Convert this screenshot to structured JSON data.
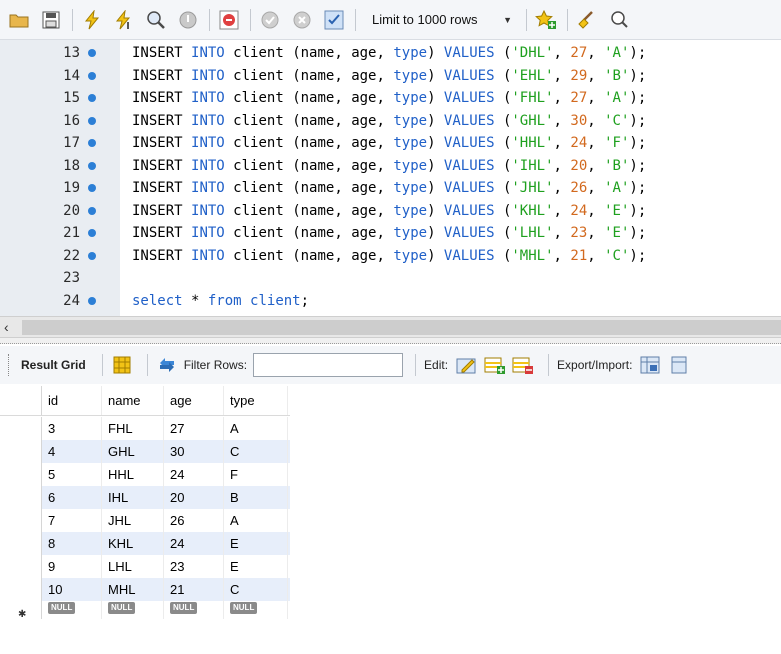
{
  "toolbar": {
    "limit_label": "Limit to 1000 rows",
    "icons": [
      "folder-icon",
      "save-icon",
      "lightning-icon",
      "lightning-cursor-icon",
      "magnifier-explain-icon",
      "stop-icon",
      "toggle-continue-icon",
      "commit-icon",
      "rollback-icon",
      "autocommit-icon",
      "beautify-icon",
      "find-icon",
      "invisible-chars-icon"
    ]
  },
  "editor": {
    "lines": [
      {
        "num": "13",
        "dot": true,
        "tokens": [
          [
            "k",
            "INSERT "
          ],
          [
            "b",
            "INTO "
          ],
          [
            "k",
            "client "
          ],
          [
            "k",
            "(name, age, "
          ],
          [
            "b",
            "type"
          ],
          [
            "k",
            ") "
          ],
          [
            "b",
            "VALUES "
          ],
          [
            "k",
            "("
          ],
          [
            "s",
            "'DHL'"
          ],
          [
            "k",
            ", "
          ],
          [
            "n",
            "27"
          ],
          [
            "k",
            ", "
          ],
          [
            "s",
            "'A'"
          ],
          [
            "k",
            ");"
          ]
        ]
      },
      {
        "num": "14",
        "dot": true,
        "tokens": [
          [
            "k",
            "INSERT "
          ],
          [
            "b",
            "INTO "
          ],
          [
            "k",
            "client "
          ],
          [
            "k",
            "(name, age, "
          ],
          [
            "b",
            "type"
          ],
          [
            "k",
            ") "
          ],
          [
            "b",
            "VALUES "
          ],
          [
            "k",
            "("
          ],
          [
            "s",
            "'EHL'"
          ],
          [
            "k",
            ", "
          ],
          [
            "n",
            "29"
          ],
          [
            "k",
            ", "
          ],
          [
            "s",
            "'B'"
          ],
          [
            "k",
            ");"
          ]
        ]
      },
      {
        "num": "15",
        "dot": true,
        "tokens": [
          [
            "k",
            "INSERT "
          ],
          [
            "b",
            "INTO "
          ],
          [
            "k",
            "client "
          ],
          [
            "k",
            "(name, age, "
          ],
          [
            "b",
            "type"
          ],
          [
            "k",
            ") "
          ],
          [
            "b",
            "VALUES "
          ],
          [
            "k",
            "("
          ],
          [
            "s",
            "'FHL'"
          ],
          [
            "k",
            ", "
          ],
          [
            "n",
            "27"
          ],
          [
            "k",
            ", "
          ],
          [
            "s",
            "'A'"
          ],
          [
            "k",
            ");"
          ]
        ]
      },
      {
        "num": "16",
        "dot": true,
        "tokens": [
          [
            "k",
            "INSERT "
          ],
          [
            "b",
            "INTO "
          ],
          [
            "k",
            "client "
          ],
          [
            "k",
            "(name, age, "
          ],
          [
            "b",
            "type"
          ],
          [
            "k",
            ") "
          ],
          [
            "b",
            "VALUES "
          ],
          [
            "k",
            "("
          ],
          [
            "s",
            "'GHL'"
          ],
          [
            "k",
            ", "
          ],
          [
            "n",
            "30"
          ],
          [
            "k",
            ", "
          ],
          [
            "s",
            "'C'"
          ],
          [
            "k",
            ");"
          ]
        ]
      },
      {
        "num": "17",
        "dot": true,
        "tokens": [
          [
            "k",
            "INSERT "
          ],
          [
            "b",
            "INTO "
          ],
          [
            "k",
            "client "
          ],
          [
            "k",
            "(name, age, "
          ],
          [
            "b",
            "type"
          ],
          [
            "k",
            ") "
          ],
          [
            "b",
            "VALUES "
          ],
          [
            "k",
            "("
          ],
          [
            "s",
            "'HHL'"
          ],
          [
            "k",
            ", "
          ],
          [
            "n",
            "24"
          ],
          [
            "k",
            ", "
          ],
          [
            "s",
            "'F'"
          ],
          [
            "k",
            ");"
          ]
        ]
      },
      {
        "num": "18",
        "dot": true,
        "tokens": [
          [
            "k",
            "INSERT "
          ],
          [
            "b",
            "INTO "
          ],
          [
            "k",
            "client "
          ],
          [
            "k",
            "(name, age, "
          ],
          [
            "b",
            "type"
          ],
          [
            "k",
            ") "
          ],
          [
            "b",
            "VALUES "
          ],
          [
            "k",
            "("
          ],
          [
            "s",
            "'IHL'"
          ],
          [
            "k",
            ", "
          ],
          [
            "n",
            "20"
          ],
          [
            "k",
            ", "
          ],
          [
            "s",
            "'B'"
          ],
          [
            "k",
            ");"
          ]
        ]
      },
      {
        "num": "19",
        "dot": true,
        "tokens": [
          [
            "k",
            "INSERT "
          ],
          [
            "b",
            "INTO "
          ],
          [
            "k",
            "client "
          ],
          [
            "k",
            "(name, age, "
          ],
          [
            "b",
            "type"
          ],
          [
            "k",
            ") "
          ],
          [
            "b",
            "VALUES "
          ],
          [
            "k",
            "("
          ],
          [
            "s",
            "'JHL'"
          ],
          [
            "k",
            ", "
          ],
          [
            "n",
            "26"
          ],
          [
            "k",
            ", "
          ],
          [
            "s",
            "'A'"
          ],
          [
            "k",
            ");"
          ]
        ]
      },
      {
        "num": "20",
        "dot": true,
        "tokens": [
          [
            "k",
            "INSERT "
          ],
          [
            "b",
            "INTO "
          ],
          [
            "k",
            "client "
          ],
          [
            "k",
            "(name, age, "
          ],
          [
            "b",
            "type"
          ],
          [
            "k",
            ") "
          ],
          [
            "b",
            "VALUES "
          ],
          [
            "k",
            "("
          ],
          [
            "s",
            "'KHL'"
          ],
          [
            "k",
            ", "
          ],
          [
            "n",
            "24"
          ],
          [
            "k",
            ", "
          ],
          [
            "s",
            "'E'"
          ],
          [
            "k",
            ");"
          ]
        ]
      },
      {
        "num": "21",
        "dot": true,
        "tokens": [
          [
            "k",
            "INSERT "
          ],
          [
            "b",
            "INTO "
          ],
          [
            "k",
            "client "
          ],
          [
            "k",
            "(name, age, "
          ],
          [
            "b",
            "type"
          ],
          [
            "k",
            ") "
          ],
          [
            "b",
            "VALUES "
          ],
          [
            "k",
            "("
          ],
          [
            "s",
            "'LHL'"
          ],
          [
            "k",
            ", "
          ],
          [
            "n",
            "23"
          ],
          [
            "k",
            ", "
          ],
          [
            "s",
            "'E'"
          ],
          [
            "k",
            ");"
          ]
        ]
      },
      {
        "num": "22",
        "dot": true,
        "tokens": [
          [
            "k",
            "INSERT "
          ],
          [
            "b",
            "INTO "
          ],
          [
            "k",
            "client "
          ],
          [
            "k",
            "(name, age, "
          ],
          [
            "b",
            "type"
          ],
          [
            "k",
            ") "
          ],
          [
            "b",
            "VALUES "
          ],
          [
            "k",
            "("
          ],
          [
            "s",
            "'MHL'"
          ],
          [
            "k",
            ", "
          ],
          [
            "n",
            "21"
          ],
          [
            "k",
            ", "
          ],
          [
            "s",
            "'C'"
          ],
          [
            "k",
            ");"
          ]
        ]
      },
      {
        "num": "23",
        "dot": false,
        "tokens": []
      },
      {
        "num": "24",
        "dot": true,
        "tokens": [
          [
            "b",
            "select "
          ],
          [
            "k",
            "* "
          ],
          [
            "b",
            "from "
          ],
          [
            "b",
            "client"
          ],
          [
            "k",
            ";"
          ]
        ]
      }
    ]
  },
  "result_toolbar": {
    "result_grid_label": "Result Grid",
    "filter_rows_label": "Filter Rows:",
    "filter_value": "",
    "edit_label": "Edit:",
    "export_label": "Export/Import:"
  },
  "grid": {
    "columns": [
      "id",
      "name",
      "age",
      "type"
    ],
    "rows": [
      [
        "3",
        "FHL",
        "27",
        "A"
      ],
      [
        "4",
        "GHL",
        "30",
        "C"
      ],
      [
        "5",
        "HHL",
        "24",
        "F"
      ],
      [
        "6",
        "IHL",
        "20",
        "B"
      ],
      [
        "7",
        "JHL",
        "26",
        "A"
      ],
      [
        "8",
        "KHL",
        "24",
        "E"
      ],
      [
        "9",
        "LHL",
        "23",
        "E"
      ],
      [
        "10",
        "MHL",
        "21",
        "C"
      ]
    ],
    "null_label": "NULL",
    "new_row_marker": "✱"
  },
  "colors": {
    "keyword_blue": "#2060c8",
    "string_green": "#1ea01e",
    "number_orange": "#d2691e",
    "gutter": "#e9edf2",
    "row_alt": "#e7eefa"
  }
}
